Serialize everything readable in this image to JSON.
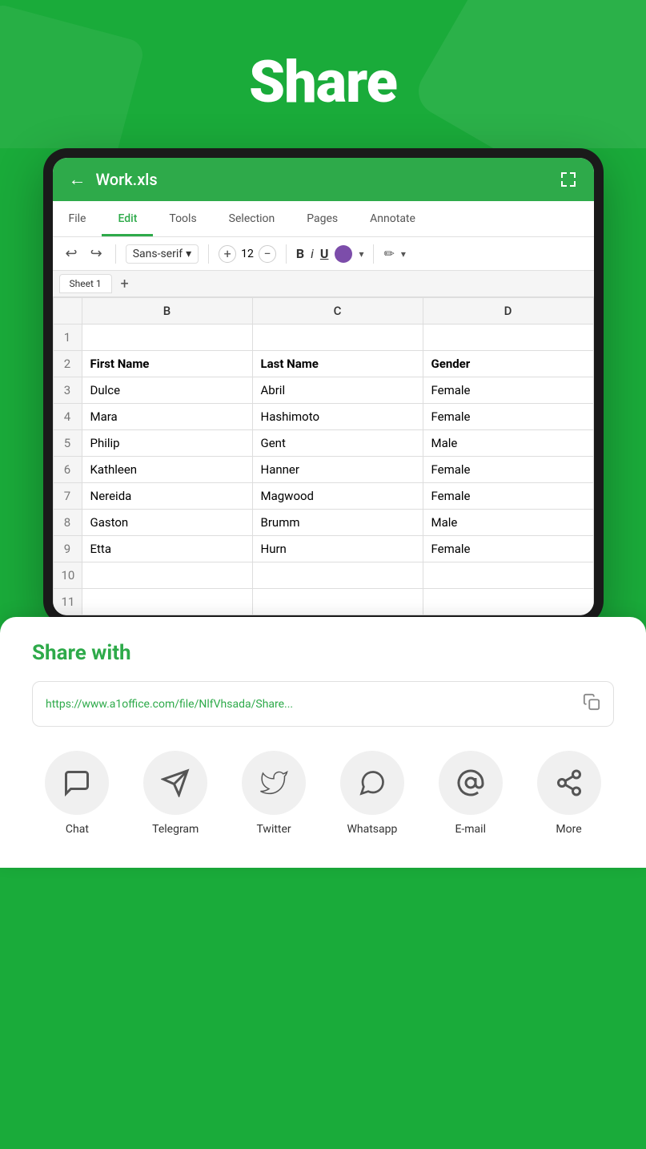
{
  "header": {
    "title": "Share",
    "background_color": "#1aab3a"
  },
  "app_bar": {
    "back_label": "←",
    "file_name": "Work.xls",
    "expand_label": "⤢"
  },
  "menu_tabs": [
    {
      "label": "File",
      "active": false
    },
    {
      "label": "Edit",
      "active": true
    },
    {
      "label": "Tools",
      "active": false
    },
    {
      "label": "Selection",
      "active": false
    },
    {
      "label": "Pages",
      "active": false
    },
    {
      "label": "Annotate",
      "active": false
    }
  ],
  "toolbar": {
    "undo_label": "↩",
    "redo_label": "↪",
    "font_name": "Sans-serif",
    "font_size": "12",
    "bold_label": "B",
    "italic_label": "i",
    "underline_label": "U",
    "color_hex": "#7c4daa"
  },
  "sheet_tabs": [
    {
      "label": "Sheet 1",
      "active": true
    }
  ],
  "spreadsheet": {
    "columns": [
      "B",
      "C",
      "D"
    ],
    "rows": [
      {
        "row_num": "1",
        "cells": [
          "",
          "",
          ""
        ]
      },
      {
        "row_num": "2",
        "cells": [
          "First Name",
          "Last Name",
          "Gender"
        ],
        "header": true
      },
      {
        "row_num": "3",
        "cells": [
          "Dulce",
          "Abril",
          "Female"
        ]
      },
      {
        "row_num": "4",
        "cells": [
          "Mara",
          "Hashimoto",
          "Female"
        ]
      },
      {
        "row_num": "5",
        "cells": [
          "Philip",
          "Gent",
          "Male"
        ]
      },
      {
        "row_num": "6",
        "cells": [
          "Kathleen",
          "Hanner",
          "Female"
        ]
      },
      {
        "row_num": "7",
        "cells": [
          "Nereida",
          "Magwood",
          "Female"
        ]
      },
      {
        "row_num": "8",
        "cells": [
          "Gaston",
          "Brumm",
          "Male"
        ]
      },
      {
        "row_num": "9",
        "cells": [
          "Etta",
          "Hurn",
          "Female"
        ]
      },
      {
        "row_num": "10",
        "cells": [
          "",
          "",
          ""
        ]
      },
      {
        "row_num": "11",
        "cells": [
          "",
          "",
          ""
        ]
      }
    ]
  },
  "share_panel": {
    "title": "Share with",
    "url": "https://www.a1office.com/file/NlfVhsada/Share...",
    "apps": [
      {
        "label": "Chat",
        "icon": "chat"
      },
      {
        "label": "Telegram",
        "icon": "telegram"
      },
      {
        "label": "Twitter",
        "icon": "twitter"
      },
      {
        "label": "Whatsapp",
        "icon": "whatsapp"
      },
      {
        "label": "E-mail",
        "icon": "email"
      },
      {
        "label": "More",
        "icon": "more"
      }
    ]
  }
}
